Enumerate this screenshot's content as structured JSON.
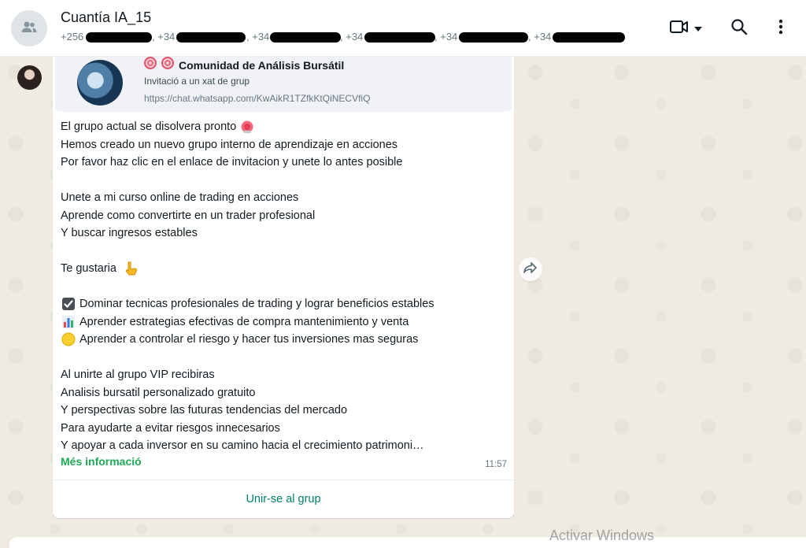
{
  "header": {
    "group_name": "Cuantía IA_15",
    "participant_prefixes": [
      "+256",
      ", +34",
      ", +34",
      ", +34",
      ", +34",
      ", +34"
    ],
    "icons": [
      "group-avatar-icon",
      "video-call-icon",
      "chevron-down-icon",
      "search-icon",
      "menu-icon"
    ]
  },
  "message": {
    "preview": {
      "title": "Comunidad de Análisis Bursátil",
      "description": "Invitació a un xat de grup",
      "url": "https://chat.whatsapp.com/KwAikR1TZfkKtQiNECVfiQ"
    },
    "lines": {
      "l1": "El grupo actual se disolvera pronto",
      "l2": "Hemos creado un nuevo grupo interno de aprendizaje en acciones",
      "l3": "Por favor haz clic en el enlace de invitacion y unete lo antes posible",
      "l4": "Unete a mi curso online de trading en acciones",
      "l5": "Aprende como convertirte en un trader profesional",
      "l6": "Y buscar ingresos estables",
      "l7": "Te gustaria",
      "l8": "Dominar tecnicas profesionales de trading y lograr beneficios estables",
      "l9": "Aprender estrategias efectivas de compra mantenimiento y venta",
      "l10": "Aprender a controlar el riesgo y hacer tus inversiones mas seguras",
      "l11": "Al unirte al grupo VIP recibiras",
      "l12": "Analisis bursatil personalizado gratuito",
      "l13": "Y perspectivas sobre las futuras tendencias del mercado",
      "l14": "Para ayudarte a evitar riesgos innecesarios",
      "l15": "Y apoyar a cada inversor en su camino hacia el crecimiento patrimoni…"
    },
    "more_label": "Més informació",
    "time": "11:57",
    "join_label": "Unir-se al grup"
  },
  "watermark": "Activar Windows",
  "colors": {
    "accent_green": "#008069",
    "link_green": "#1fa855",
    "chat_background": "#efeae2"
  }
}
